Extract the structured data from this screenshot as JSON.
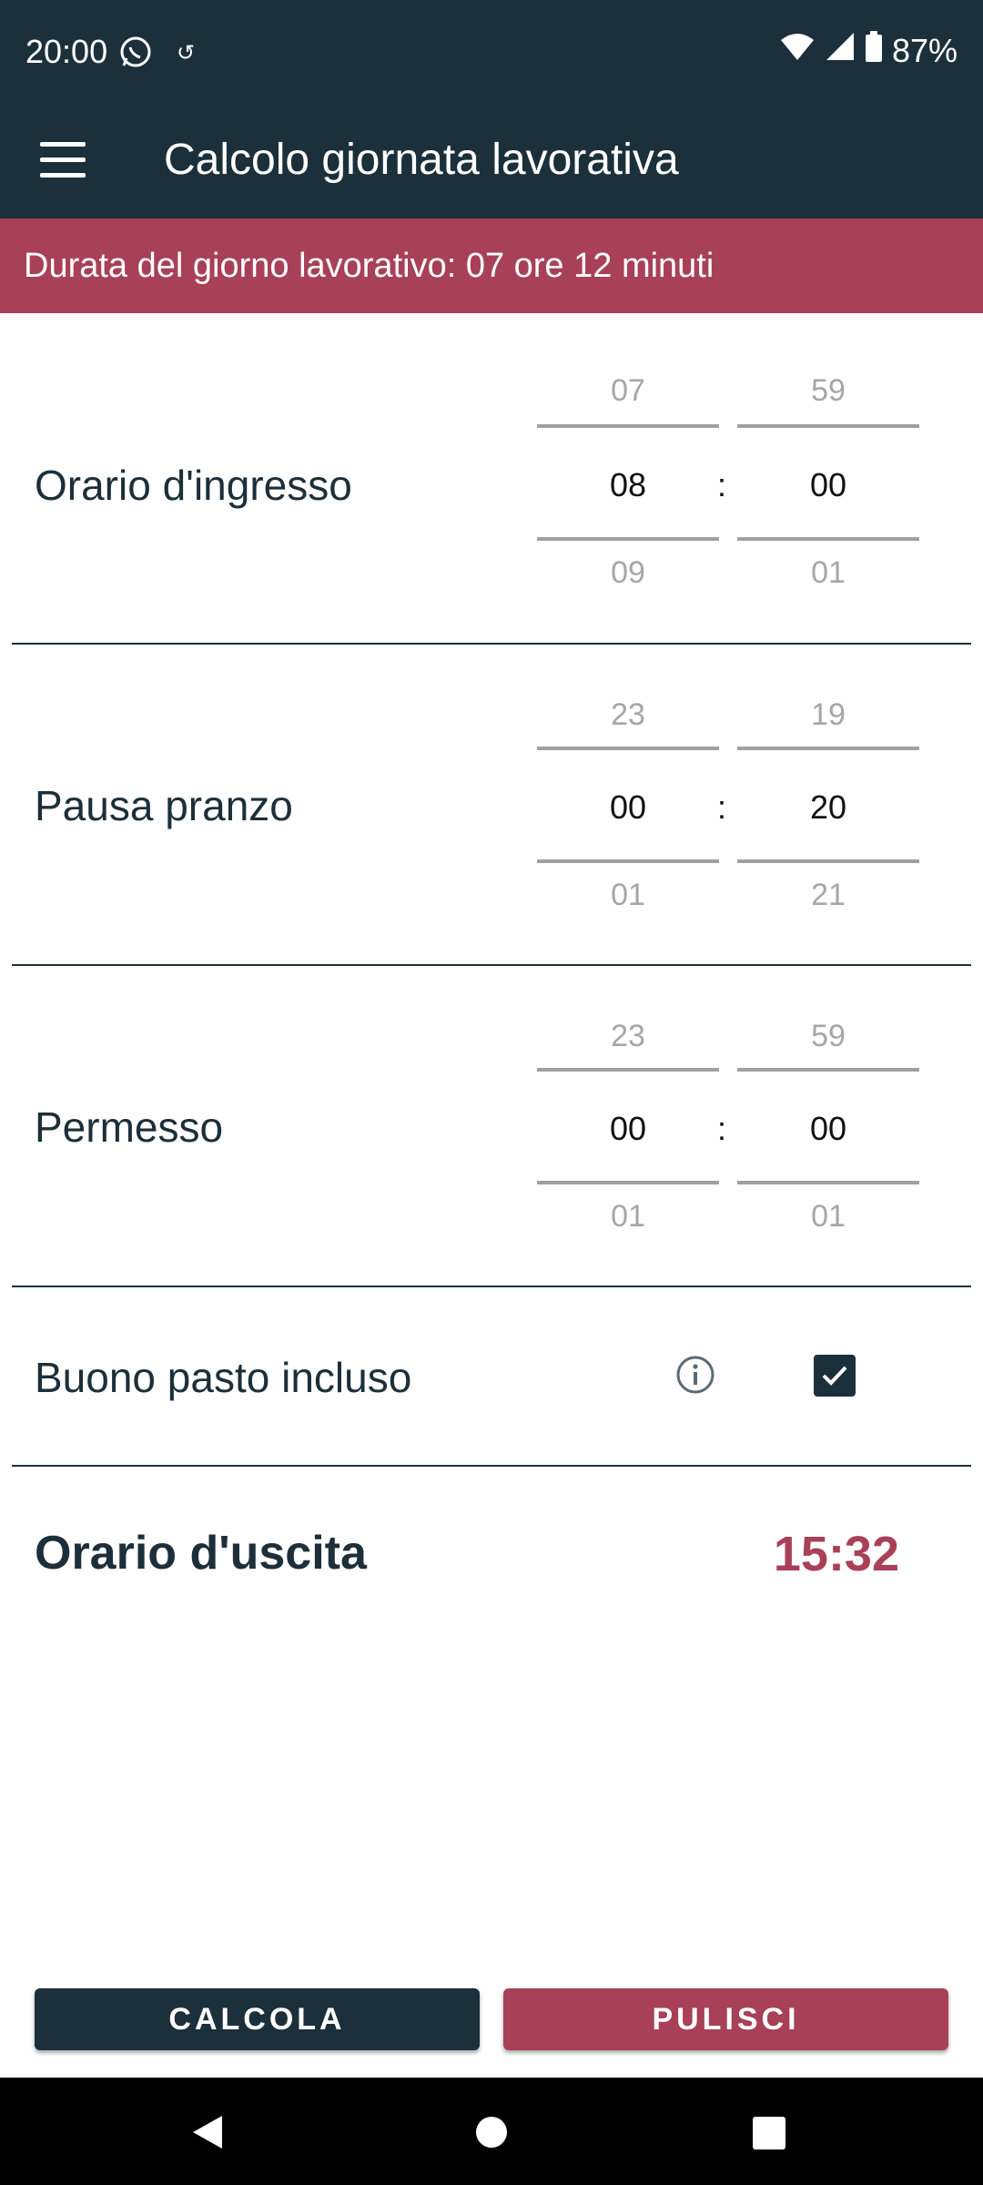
{
  "status_bar": {
    "time": "20:00",
    "battery": "87%"
  },
  "app_bar": {
    "title": "Calcolo giornata lavorativa"
  },
  "banner": {
    "text": "Durata del giorno lavorativo: 07 ore 12 minuti"
  },
  "rows": [
    {
      "label": "Orario d'ingresso",
      "hours": {
        "prev": "07",
        "value": "08",
        "next": "09"
      },
      "minutes": {
        "prev": "59",
        "value": "00",
        "next": "01"
      }
    },
    {
      "label": "Pausa pranzo",
      "hours": {
        "prev": "23",
        "value": "00",
        "next": "01"
      },
      "minutes": {
        "prev": "19",
        "value": "20",
        "next": "21"
      }
    },
    {
      "label": "Permesso",
      "hours": {
        "prev": "23",
        "value": "00",
        "next": "01"
      },
      "minutes": {
        "prev": "59",
        "value": "00",
        "next": "01"
      }
    }
  ],
  "separator": ":",
  "meal_voucher": {
    "label": "Buono pasto incluso",
    "checked": true
  },
  "exit_time": {
    "label": "Orario d'uscita",
    "value": "15:32"
  },
  "buttons": {
    "calculate": "CALCOLA",
    "clear": "PULISCI"
  },
  "colors": {
    "primary": "#1c303b",
    "accent": "#a84057"
  }
}
